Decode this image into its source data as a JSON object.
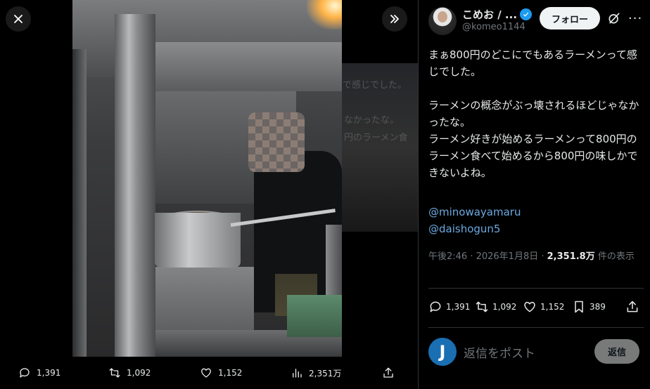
{
  "viewer": {
    "close_icon": "close-icon",
    "expand_icon": "chevron-double-right-icon",
    "ghost_lines": [
      "で感じでした。",
      "なかったな。",
      "円のラーメン食"
    ]
  },
  "bottom_bar": {
    "reply_count": "1,391",
    "retweet_count": "1,092",
    "like_count": "1,152",
    "views_count": "2,351万"
  },
  "author": {
    "name": "こめお / ...",
    "handle": "@komeo1144",
    "follow_label": "フォロー"
  },
  "tweet": {
    "text": "まぁ800円のどこにでもあるラーメンって感じでした。\n\nラーメンの概念がぶっ壊されるほどじゃなかったな。\nラーメン好きが始めるラーメンって800円のラーメン食べて始めるから800円の味しかできないよね。",
    "mentions": [
      "@minowayamaru",
      "@daishogun5"
    ],
    "time": "午後2:46 · 2026年1月8日 · ",
    "views": "2,351.8万",
    "views_suffix": " 件の表示"
  },
  "actions": {
    "reply": "1,391",
    "retweet": "1,092",
    "like": "1,152",
    "bookmark": "389"
  },
  "reply_box": {
    "avatar_letter": "J",
    "placeholder": "返信をポスト",
    "button": "返信"
  },
  "colors": {
    "link": "#6aa9e0",
    "verified": "#1d9bf0",
    "muted": "#71767b"
  }
}
